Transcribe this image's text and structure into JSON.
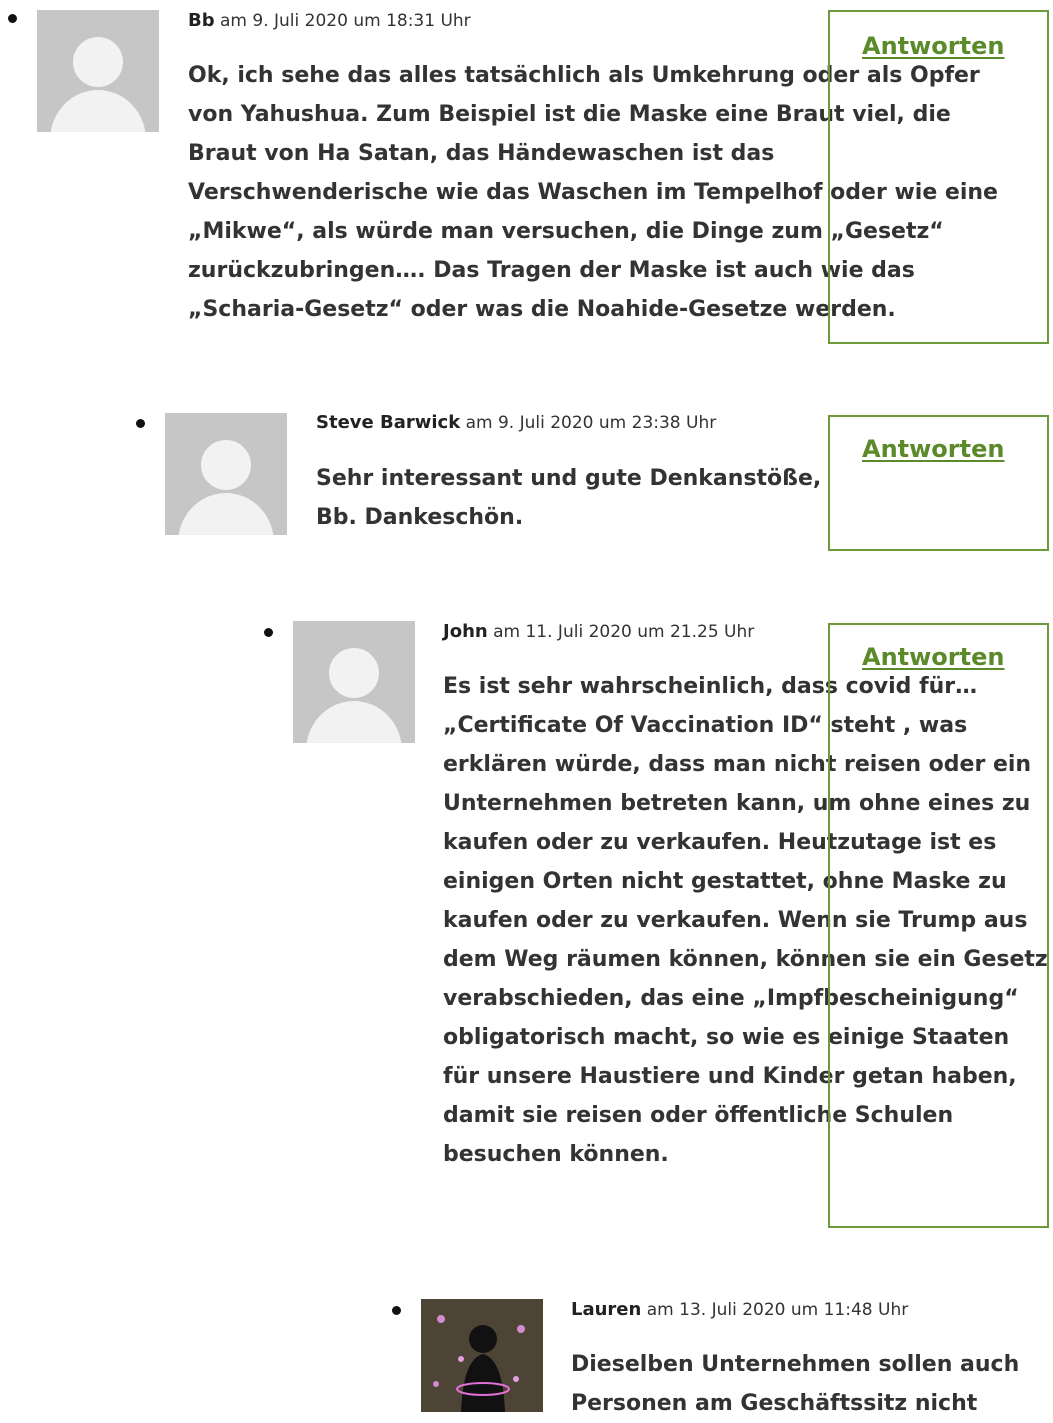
{
  "comments": [
    {
      "author": "Bb",
      "date": "am 9. Juli 2020 um 18:31 Uhr",
      "reply_label": "Antworten",
      "text": "Ok, ich sehe das alles tatsächlich als Umkehrung oder als Opfer von Yahushua. Zum Beispiel ist die Maske eine Braut viel, die Braut von Ha Satan, das Händewaschen ist das Verschwenderische wie das Waschen im Tempelhof oder wie eine „Mikwe“, als würde man versuchen, die Dinge zum „Gesetz“ zurückzubringen…. Das Tragen der Maske ist auch wie das „Scharia-Gesetz“ oder was die Noahide-Gesetze werden."
    },
    {
      "author": "Steve Barwick",
      "date": "am 9. Juli 2020 um 23:38 Uhr",
      "reply_label": "Antworten",
      "text": "Sehr interessant und gute Denkanstöße, Bb. Dankeschön."
    },
    {
      "author": "John",
      "date": "am 11. Juli 2020 um 21.25 Uhr",
      "reply_label": "Antworten",
      "text": "Es ist sehr wahrscheinlich, dass covid für… „Certificate Of Vaccination ID“ steht , was erklären würde, dass man nicht reisen oder ein Unternehmen betreten kann, um ohne eines zu kaufen oder zu verkaufen. Heutzutage ist es einigen Orten nicht gestattet, ohne Maske zu kaufen oder zu verkaufen. Wenn sie Trump aus dem Weg räumen können, können sie ein Gesetz verabschieden, das eine „Impfbescheinigung“ obligatorisch macht, so wie es einige Staaten für unsere Haustiere und Kinder getan haben, damit sie reisen oder öffentliche Schulen besuchen können."
    },
    {
      "author": "Lauren",
      "date": "am 13. Juli 2020 um 11:48 Uhr",
      "text": "Dieselben Unternehmen sollen auch Personen am Geschäftssitz nicht"
    }
  ],
  "colors": {
    "accent": "#6b9a3a",
    "link": "#5b8a2a",
    "avatar_bg": "#c6c6c6"
  },
  "icons": {
    "default_avatar": "person-silhouette-icon",
    "bullet": "bullet-dot"
  }
}
